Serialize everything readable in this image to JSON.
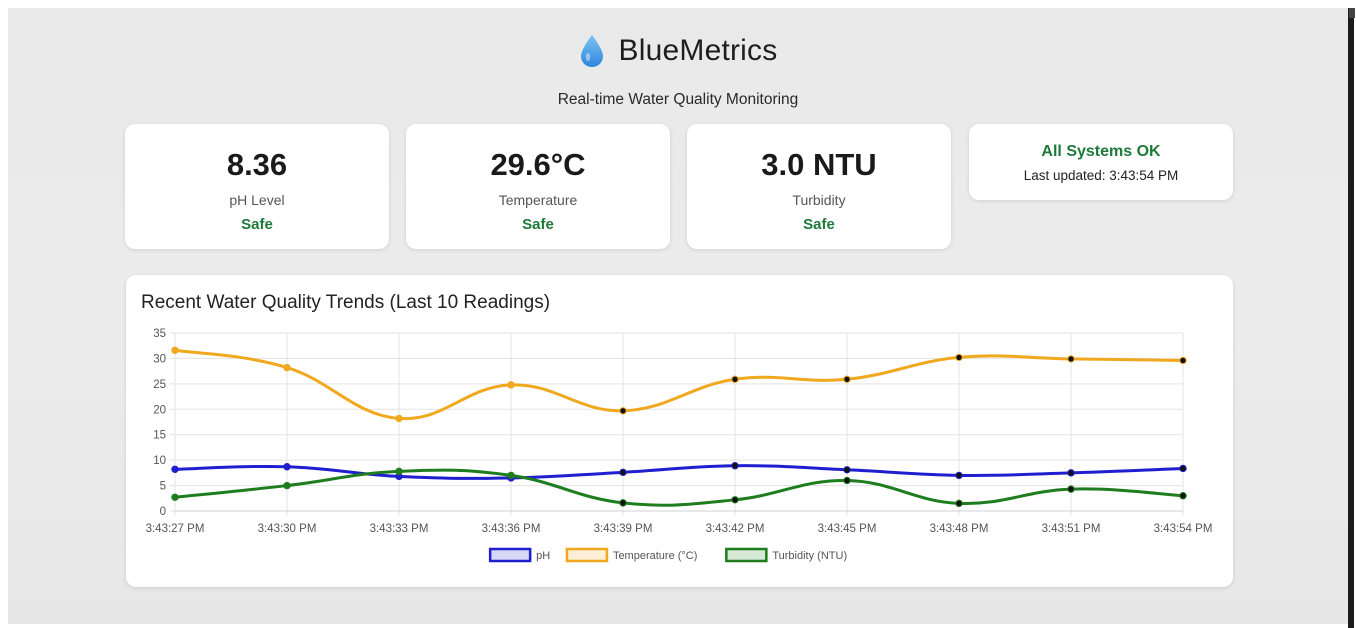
{
  "app": {
    "title": "BlueMetrics",
    "subtitle": "Real-time Water Quality Monitoring",
    "icon": "water-drop-icon"
  },
  "metrics": [
    {
      "value": "8.36",
      "label": "pH Level",
      "status": "Safe"
    },
    {
      "value": "29.6°C",
      "label": "Temperature",
      "status": "Safe"
    },
    {
      "value": "3.0 NTU",
      "label": "Turbidity",
      "status": "Safe"
    }
  ],
  "system": {
    "status": "All Systems OK",
    "updated": "Last updated: 3:43:54 PM"
  },
  "colors": {
    "ok": "#1e7a3a",
    "ph": "#1f1fd0",
    "temperature": "#f0a81e",
    "turbidity": "#1e7d1e",
    "drop_top": "#7cc3f5",
    "drop_bottom": "#2f86dd"
  },
  "chart_data": {
    "type": "line",
    "title": "Recent Water Quality Trends (Last 10 Readings)",
    "x": [
      "3:43:27 PM",
      "3:43:30 PM",
      "3:43:33 PM",
      "3:43:36 PM",
      "3:43:39 PM",
      "3:43:42 PM",
      "3:43:45 PM",
      "3:43:48 PM",
      "3:43:51 PM",
      "3:43:54 PM"
    ],
    "ylim": [
      0,
      35
    ],
    "yticks": [
      0,
      5,
      10,
      15,
      20,
      25,
      30,
      35
    ],
    "grid": true,
    "legend_position": "bottom",
    "series": [
      {
        "name": "pH",
        "color": "#1f1fd0",
        "values": [
          8.2,
          8.7,
          6.8,
          6.5,
          7.6,
          8.9,
          8.1,
          7.0,
          7.5,
          8.36
        ]
      },
      {
        "name": "Temperature (°C)",
        "color": "#f0a81e",
        "values": [
          31.6,
          28.2,
          18.2,
          24.8,
          19.7,
          25.9,
          25.9,
          30.2,
          29.9,
          29.6
        ]
      },
      {
        "name": "Turbidity (NTU)",
        "color": "#1e7d1e",
        "values": [
          2.7,
          5.0,
          7.8,
          7.0,
          1.6,
          2.2,
          6.0,
          1.5,
          4.3,
          3.0
        ]
      }
    ]
  }
}
